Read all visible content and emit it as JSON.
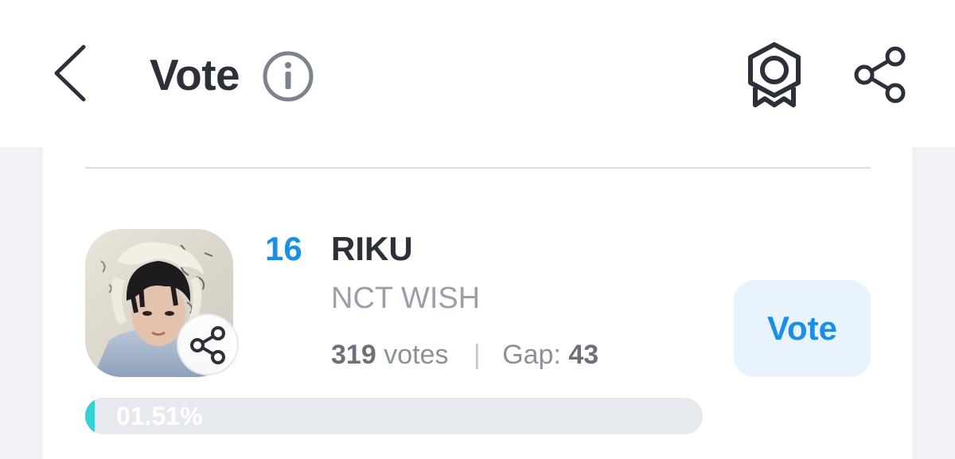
{
  "header": {
    "title": "Vote",
    "icons": {
      "back": "chevron-left-icon",
      "info": "info-icon",
      "badge": "award-badge-icon",
      "share": "share-icon"
    }
  },
  "candidate": {
    "rank": "16",
    "name": "RIKU",
    "group": "NCT WISH",
    "votes_count": "319",
    "votes_label": "votes",
    "separator": "|",
    "gap_label": "Gap:",
    "gap_value": "43",
    "vote_button_label": "Vote",
    "percent_text": "01.51%",
    "percent_value": 1.51
  },
  "colors": {
    "accent": "#1a8fe8",
    "progress": "#34d0d6",
    "title": "#2c3039"
  }
}
